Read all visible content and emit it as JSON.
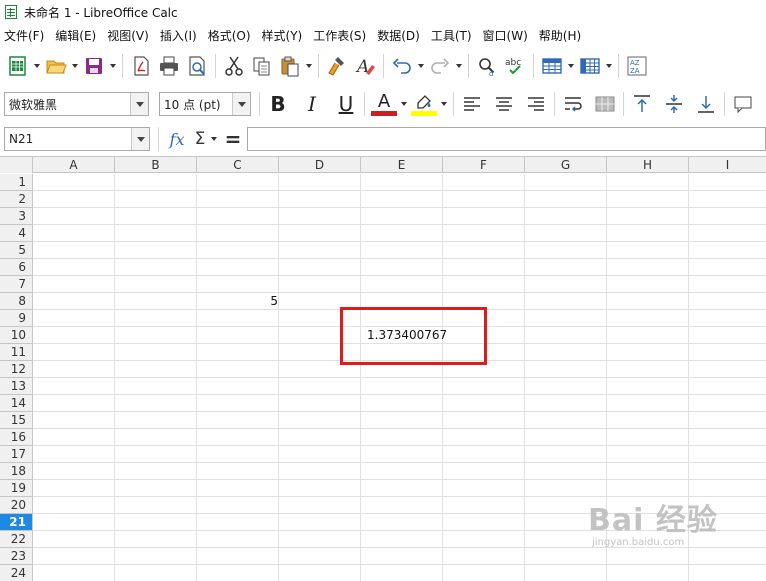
{
  "window": {
    "title": "未命名 1 - LibreOffice Calc"
  },
  "menu": [
    "文件(F)",
    "编辑(E)",
    "视图(V)",
    "插入(I)",
    "格式(O)",
    "样式(Y)",
    "工作表(S)",
    "数据(D)",
    "工具(T)",
    "窗口(W)",
    "帮助(H)"
  ],
  "format_bar": {
    "font_name": "微软雅黑",
    "font_size": "10 点 (pt)",
    "bold": "B",
    "italic": "I",
    "underline": "U",
    "font_color_letter": "A",
    "font_color": "#c9211e",
    "highlight_color": "#ffff00"
  },
  "formula_bar": {
    "name_box": "N21",
    "fx": "fx",
    "sigma": "Σ",
    "equals": "=",
    "formula_value": ""
  },
  "columns": [
    "A",
    "B",
    "C",
    "D",
    "E",
    "F",
    "G",
    "H",
    "I"
  ],
  "rows": [
    "1",
    "2",
    "3",
    "4",
    "5",
    "6",
    "7",
    "8",
    "9",
    "10",
    "11",
    "12",
    "13",
    "14",
    "15",
    "16",
    "17",
    "18",
    "19",
    "20",
    "21",
    "22",
    "23",
    "24"
  ],
  "active_row": "21",
  "cells": {
    "C8": "5",
    "E10": "1.373400767"
  },
  "toolbar_icons": [
    "new-icon",
    "open-icon",
    "save-icon",
    "export-pdf-icon",
    "print-icon",
    "print-preview-icon",
    "cut-icon",
    "copy-icon",
    "paste-icon",
    "clone-format-icon",
    "clear-format-icon",
    "undo-icon",
    "redo-icon",
    "find-replace-icon",
    "spelling-icon",
    "row-icon",
    "column-icon",
    "sort-icon"
  ],
  "watermark": {
    "main": "Bai 经验",
    "sub": "jingyan.baidu.com"
  },
  "colors": {
    "highlight_border": "#e01b1b",
    "active_row_bg": "#1e88e5"
  }
}
